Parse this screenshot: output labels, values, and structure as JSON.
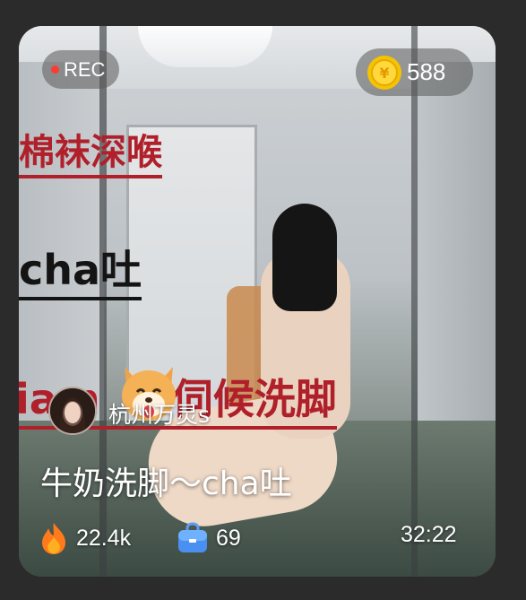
{
  "badge": {
    "rec_label": "REC"
  },
  "coins": {
    "value": "588",
    "icon": "coin-yen-icon",
    "color": "#f5c400"
  },
  "overlay_text": {
    "line1": "棉袜深喉",
    "line2": "cha吐",
    "line3": "iam",
    "line3_rest": "伺候洗脚"
  },
  "author": {
    "name": "杭州万灵s"
  },
  "video": {
    "title": "牛奶洗脚～cha吐",
    "duration": "32:22"
  },
  "stats": {
    "popularity": "22.4k",
    "popularity_icon": "fire-icon",
    "goods": "69",
    "goods_icon": "shopping-bag-icon"
  },
  "colors": {
    "rec_dot": "#ff3b30",
    "overlay_red": "#b0202a"
  }
}
